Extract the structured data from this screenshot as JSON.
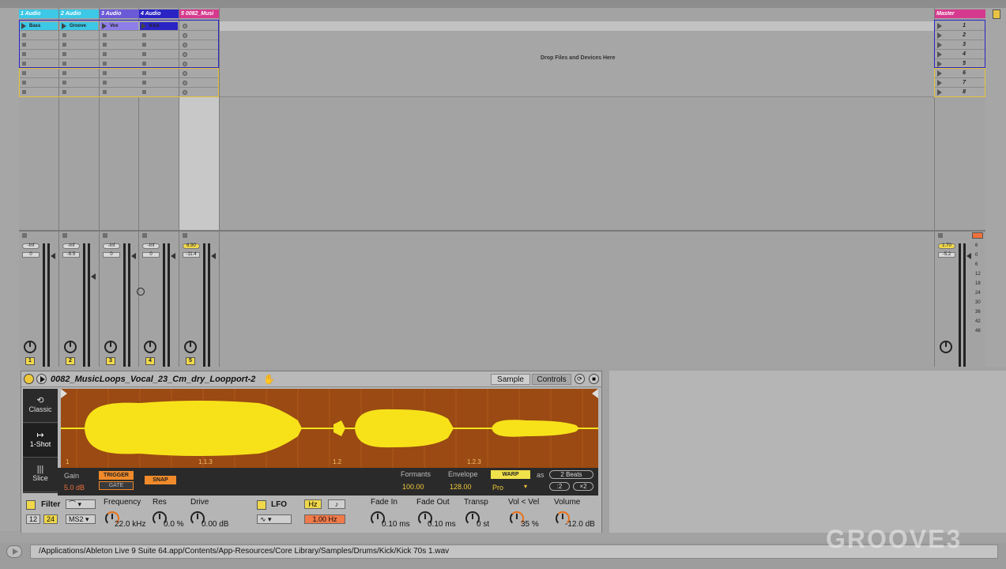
{
  "tracks": [
    {
      "name": "1 Audio",
      "color": "#3cc8e6",
      "clip": "Bass",
      "clip_color": "#3cc8e6",
      "vol": "-Inf",
      "vol_value": "0",
      "num": "1"
    },
    {
      "name": "2 Audio",
      "color": "#3cc8e6",
      "clip": "Groove",
      "clip_color": "#3cc8e6",
      "vol": "-Inf",
      "vol_value": "-8.5",
      "num": "2"
    },
    {
      "name": "3 Audio",
      "color": "#6a5ad6",
      "clip": "Vox",
      "clip_color": "#8e7ee8",
      "vol": "-Inf",
      "vol_value": "0",
      "num": "3"
    },
    {
      "name": "4 Audio",
      "color": "#2a24c4",
      "clip": "Kick",
      "clip_color": "#2a24c4",
      "vol": "-Inf",
      "vol_value": "0",
      "num": "4"
    },
    {
      "name": "5 0082_Musi",
      "color": "#d63a8e",
      "clip": "",
      "clip_color": "",
      "vol": "6.90",
      "vol_value": "-11.4",
      "num": "5"
    }
  ],
  "master": {
    "name": "Master",
    "color": "#d63a8e",
    "vol": "1.70",
    "vol_value": "-5.2"
  },
  "scenes": [
    "1",
    "2",
    "3",
    "4",
    "5",
    "6",
    "7",
    "8"
  ],
  "drop_text": "Drop Files and Devices Here",
  "db_scale": [
    "6",
    "0",
    "6",
    "12",
    "18",
    "24",
    "30",
    "36",
    "42",
    "48"
  ],
  "device": {
    "title": "0082_MusicLoops_Vocal_23_Cm_dry_Loopport-2",
    "tabs": [
      "Sample",
      "Controls"
    ],
    "modes": [
      {
        "label": "Classic",
        "glyph": "⟲"
      },
      {
        "label": "1-Shot",
        "glyph": "↦"
      },
      {
        "label": "Slice",
        "glyph": "|||"
      }
    ],
    "wave_markers": [
      "1",
      "1.1.3",
      "1.2",
      "1.2.3"
    ],
    "gain_label": "Gain",
    "gain_value": "5.0 dB",
    "trigger_label": "TRIGGER",
    "gate_label": "GATE",
    "snap_label": "SNAP",
    "formants_label": "Formants",
    "formants_value": "100.00",
    "envelope_label": "Envelope",
    "envelope_value": "128.00",
    "warp_label": "WARP",
    "as_label": "as",
    "beats_label": "2 Beats",
    "warp_mode": "Pro",
    "div_label": ":2",
    "mul_label": "×2",
    "filter_label": "Filter",
    "filter_12": "12",
    "filter_24": "24",
    "filter_type": "MS2",
    "frequency_label": "Frequency",
    "frequency_value": "22.0 kHz",
    "res_label": "Res",
    "res_value": "0.0 %",
    "drive_label": "Drive",
    "drive_value": "0.00 dB",
    "lfo_label": "LFO",
    "hz_label": "Hz",
    "lfo_rate": "1.00 Hz",
    "fadein_label": "Fade In",
    "fadein_value": "0.10 ms",
    "fadeout_label": "Fade Out",
    "fadeout_value": "0.10 ms",
    "transp_label": "Transp",
    "transp_value": "0 st",
    "volvel_label": "Vol < Vel",
    "volvel_value": "35 %",
    "volume_label": "Volume",
    "volume_value": "-12.0 dB"
  },
  "status_path": "/Applications/Ableton Live 9 Suite 64.app/Contents/App-Resources/Core Library/Samples/Drums/Kick/Kick 70s 1.wav",
  "watermark": "GROOVE3"
}
